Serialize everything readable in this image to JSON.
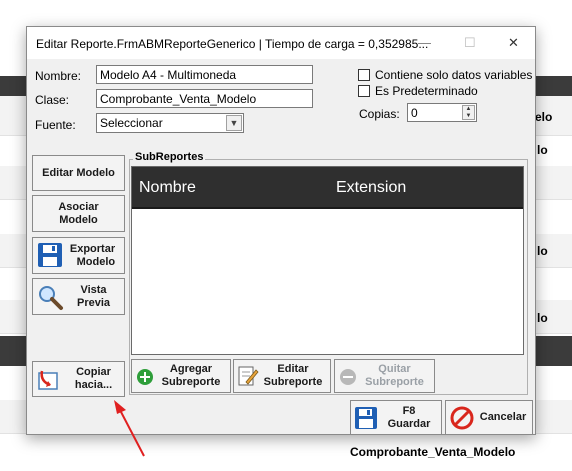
{
  "background": {
    "cells": [
      "elo",
      "lo",
      "lo",
      "lo"
    ],
    "footer_value": "Comprobante_Venta_Modelo"
  },
  "dialog": {
    "title": "Editar Reporte.FrmABMReporteGenerico | Tiempo de carga = 0,352985...",
    "window_controls": {
      "minimize": "—",
      "maximize": "☐",
      "close": "✕"
    },
    "fields": {
      "nombre_label": "Nombre:",
      "nombre_value": "Modelo A4 - Multimoneda",
      "clase_label": "Clase:",
      "clase_value": "Comprobante_Venta_Modelo",
      "fuente_label": "Fuente:",
      "fuente_value": "Seleccionar",
      "copias_label": "Copias:",
      "copias_value": "0"
    },
    "checkboxes": {
      "solo_datos": "Contiene solo datos variables",
      "predeterminado": "Es Predeterminado"
    },
    "side_buttons": {
      "editar_modelo": "Editar Modelo",
      "asociar_1": "Asociar",
      "asociar_2": "Modelo",
      "exportar_1": "Exportar",
      "exportar_2": "Modelo",
      "vista_1": "Vista",
      "vista_2": "Previa",
      "copiar_1": "Copiar",
      "copiar_2": "hacia..."
    },
    "subreportes": {
      "group_title": "SubReportes",
      "columns": [
        "Nombre",
        "Extension"
      ],
      "agregar_1": "Agregar",
      "agregar_2": "Subreporte",
      "editar_1": "Editar",
      "editar_2": "Subreporte",
      "quitar_1": "Quitar",
      "quitar_2": "Subreporte"
    },
    "footer_buttons": {
      "guardar_1": "F8",
      "guardar_2": "Guardar",
      "cancelar": "Cancelar"
    }
  },
  "colors": {
    "grid_header": "#2f2f2f",
    "accent_save": "#1f5fb4",
    "accent_cancel": "#d9261c",
    "annotation_arrow": "#e02020"
  }
}
